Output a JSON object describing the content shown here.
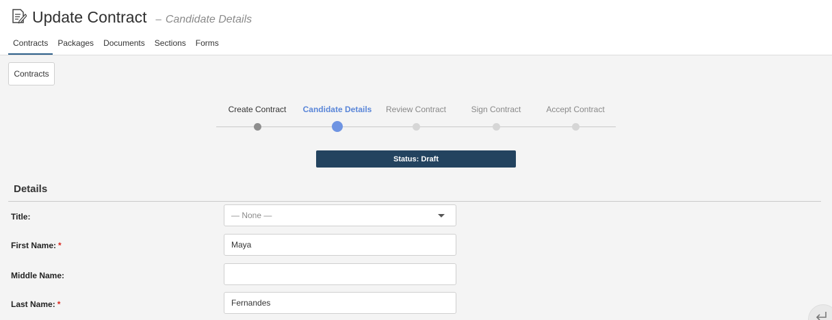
{
  "header": {
    "title": "Update Contract",
    "separator": "–",
    "subtitle": "Candidate Details",
    "icon": "edit-document-icon"
  },
  "tabs": [
    {
      "label": "Contracts",
      "active": true
    },
    {
      "label": "Packages",
      "active": false
    },
    {
      "label": "Documents",
      "active": false
    },
    {
      "label": "Sections",
      "active": false
    },
    {
      "label": "Forms",
      "active": false
    }
  ],
  "toolbar": {
    "contracts_button": "Contracts"
  },
  "stepper": {
    "steps": [
      {
        "label": "Create Contract",
        "state": "done"
      },
      {
        "label": "Candidate Details",
        "state": "active"
      },
      {
        "label": "Review Contract",
        "state": "pending"
      },
      {
        "label": "Sign Contract",
        "state": "pending"
      },
      {
        "label": "Accept Contract",
        "state": "pending"
      }
    ]
  },
  "status": {
    "label": "Status: Draft"
  },
  "details": {
    "section_title": "Details",
    "fields": {
      "title": {
        "label": "Title:",
        "value": "— None —",
        "required": false
      },
      "first_name": {
        "label": "First Name:",
        "value": "Maya",
        "required": true
      },
      "middle_name": {
        "label": "Middle Name:",
        "value": "",
        "required": false
      },
      "last_name": {
        "label": "Last Name:",
        "value": "Fernandes",
        "required": true
      }
    },
    "required_marker": "*"
  },
  "colors": {
    "accent": "#6f94e2",
    "status_bar": "#23435f",
    "required": "#d9261c",
    "tab_underline": "#2d5f8a"
  },
  "floating_action": {
    "icon": "enter-arrow-icon"
  }
}
